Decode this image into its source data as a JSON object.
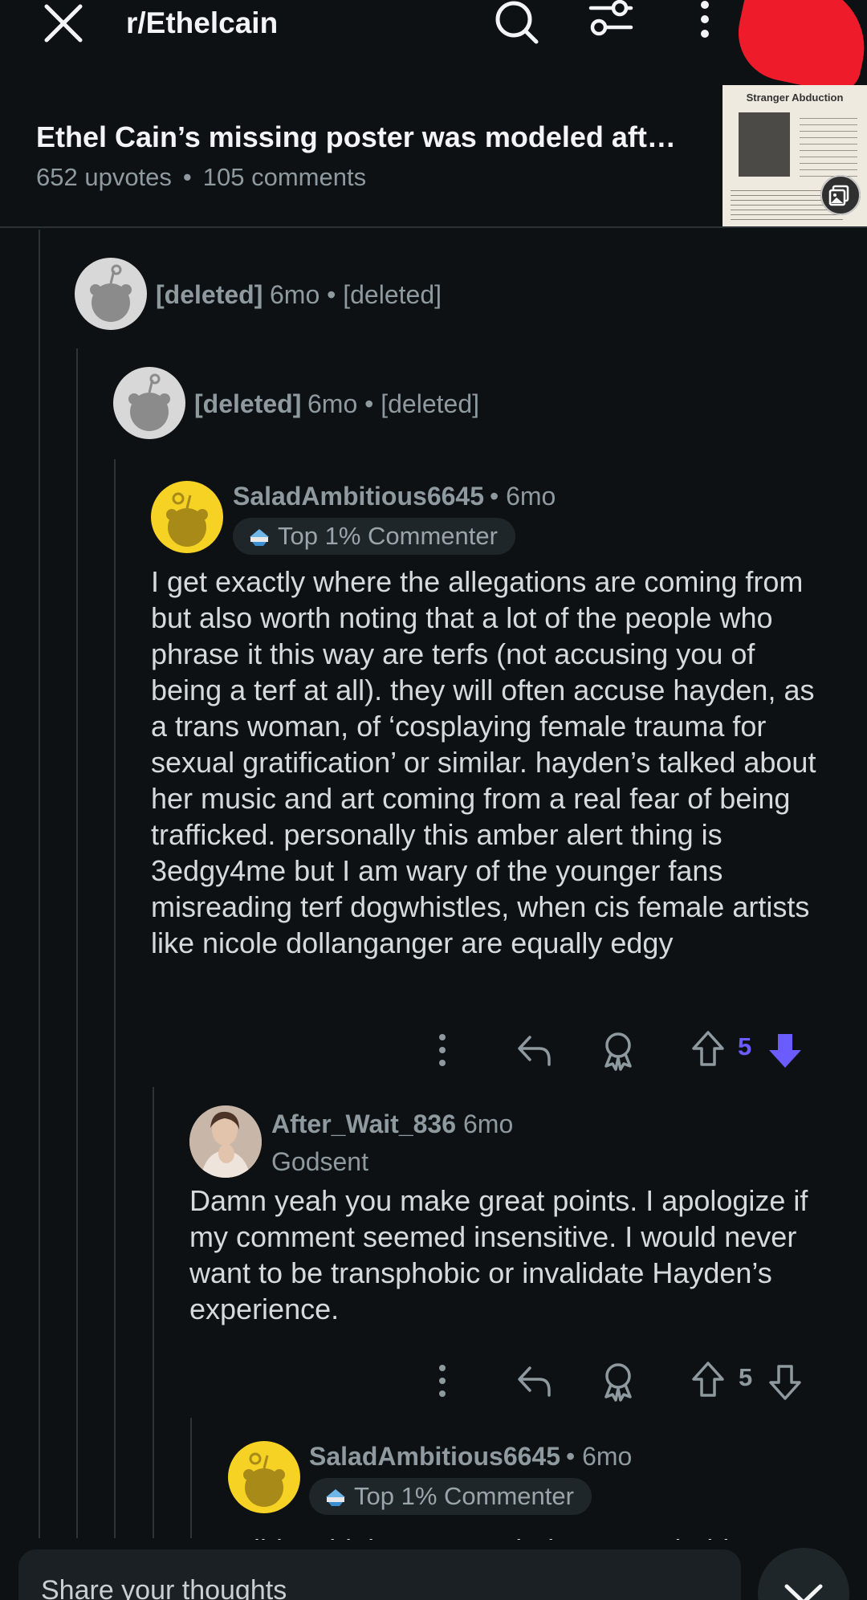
{
  "header": {
    "subreddit": "r/Ethelcain",
    "post_title": "Ethel Cain’s missing poster was modeled aft…",
    "upvotes": "652 upvotes",
    "separator": "•",
    "comments": "105 comments",
    "thumbnail_title": "Stranger Abduction"
  },
  "comments": [
    {
      "username": "[deleted]",
      "meta": "6mo • [deleted]"
    },
    {
      "username": "[deleted]",
      "meta": "6mo • [deleted]"
    },
    {
      "username": "SaladAmbitious6645",
      "meta": "• 6mo",
      "flair": "Top 1% Commenter",
      "body": "I get exactly where the allegations are coming from but also worth noting that a lot of the people who phrase it this way are terfs (not accusing you of being a terf at all). they will often accuse hayden, as a trans woman, of ‘cosplaying female trauma for sexual gratification’ or similar. hayden’s talked about her music and art coming from a real fear of being trafficked. personally this amber alert thing is 3edgy4me but I am wary of the younger fans misreading terf dogwhistles, when cis female artists like nicole dollanganger are equally edgy",
      "votes": "5",
      "downvoted": true
    },
    {
      "username": "After_Wait_836",
      "meta": "6mo",
      "flair": "Godsent",
      "body": "Damn yeah you make great points. I apologize if my comment seemed insensitive. I would never want to be transphobic or invalidate Hayden’s experience.",
      "votes": "5",
      "downvoted": false
    },
    {
      "username": "SaladAmbitious6645",
      "meta": "• 6mo",
      "flair": "Top 1% Commenter",
      "body_partial": "I didn’t think you were being transphobic at"
    }
  ],
  "composer": {
    "placeholder": "Share your thoughts"
  },
  "colors": {
    "background": "#0e1113",
    "meta_text": "#8e9a9f",
    "downvote": "#6a5cff",
    "default_avatar": "#d8d8d8",
    "snoo_yellow": "#f5d223"
  }
}
